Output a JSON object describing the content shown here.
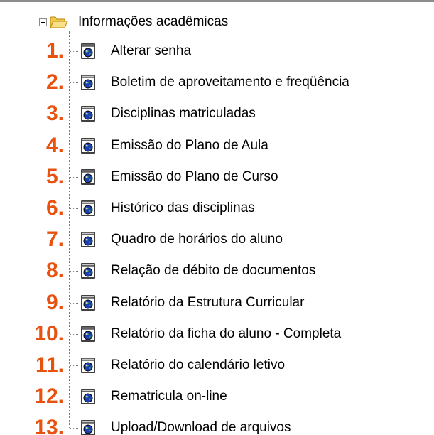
{
  "folder": {
    "label": "Informações acadêmicas",
    "icon": "folder-open-icon",
    "toggle_icon": "minus-box-icon"
  },
  "colors": {
    "number": "#e8520e",
    "text": "#000000",
    "tree_line": "#7a7a7a"
  },
  "items": [
    {
      "num": "1.",
      "label": "Alterar senha",
      "icon": "globe-page-icon"
    },
    {
      "num": "2.",
      "label": "Boletim de aproveitamento e freqüência",
      "icon": "globe-page-icon"
    },
    {
      "num": "3.",
      "label": "Disciplinas matriculadas",
      "icon": "globe-page-icon"
    },
    {
      "num": "4.",
      "label": "Emissão do Plano de Aula",
      "icon": "globe-page-icon"
    },
    {
      "num": "5.",
      "label": "Emissão do Plano de Curso",
      "icon": "globe-page-icon"
    },
    {
      "num": "6.",
      "label": "Histórico das disciplinas",
      "icon": "globe-page-icon"
    },
    {
      "num": "7.",
      "label": "Quadro de horários do aluno",
      "icon": "globe-page-icon"
    },
    {
      "num": "8.",
      "label": "Relação de débito de documentos",
      "icon": "globe-page-icon"
    },
    {
      "num": "9.",
      "label": "Relatório da Estrutura Curricular",
      "icon": "globe-page-icon"
    },
    {
      "num": "10.",
      "label": "Relatório da ficha do aluno - Completa",
      "icon": "globe-page-icon"
    },
    {
      "num": "11.",
      "label": "Relatório do calendário letivo",
      "icon": "globe-page-icon"
    },
    {
      "num": "12.",
      "label": "Rematricula on-line",
      "icon": "globe-page-icon"
    },
    {
      "num": "13.",
      "label": "Upload/Download de arquivos",
      "icon": "globe-page-icon"
    }
  ]
}
